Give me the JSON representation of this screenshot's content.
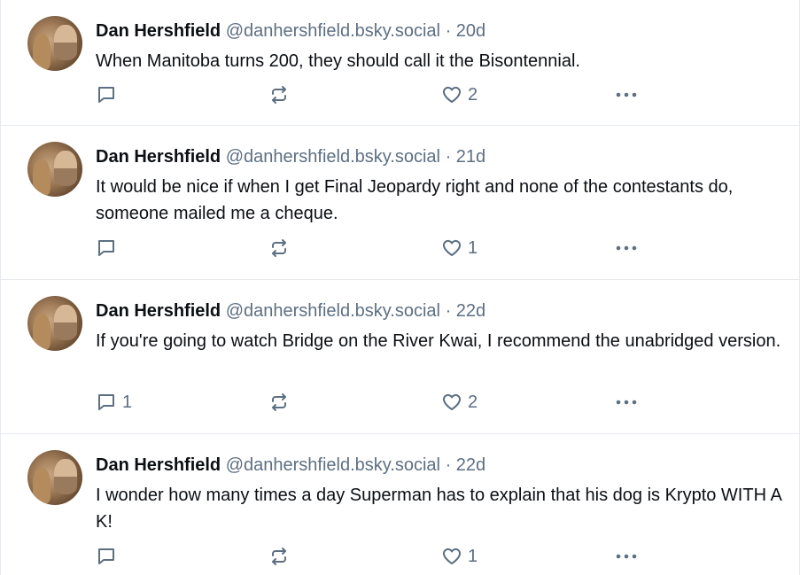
{
  "posts": [
    {
      "author": "Dan Hershfield",
      "handle": "@danhershfield.bsky.social",
      "separator": "·",
      "time": "20d",
      "text": "When Manitoba turns 200, they should call it the Bisontennial.",
      "replies": "",
      "likes": "2"
    },
    {
      "author": "Dan Hershfield",
      "handle": "@danhershfield.bsky.social",
      "separator": "·",
      "time": "21d",
      "text": "It would be nice if when I get Final Jeopardy right and none of the contestants do, someone mailed me a cheque.",
      "replies": "",
      "likes": "1"
    },
    {
      "author": "Dan Hershfield",
      "handle": "@danhershfield.bsky.social",
      "separator": "·",
      "time": "22d",
      "text": "If you're going to watch Bridge on the River Kwai, I recommend the unabridged version.",
      "replies": "1",
      "likes": "2"
    },
    {
      "author": "Dan Hershfield",
      "handle": "@danhershfield.bsky.social",
      "separator": "·",
      "time": "22d",
      "text": "I wonder how many times a day Superman has to explain that his dog is Krypto WITH A K!",
      "replies": "",
      "likes": "1"
    }
  ],
  "icons": {
    "reply": "speech-bubble-icon",
    "repost": "repost-arrows-icon",
    "like": "heart-icon",
    "more": "ellipsis-icon"
  },
  "colors": {
    "text": "#0b0f14",
    "muted": "#5d6f83",
    "divider": "#e6eaee"
  }
}
